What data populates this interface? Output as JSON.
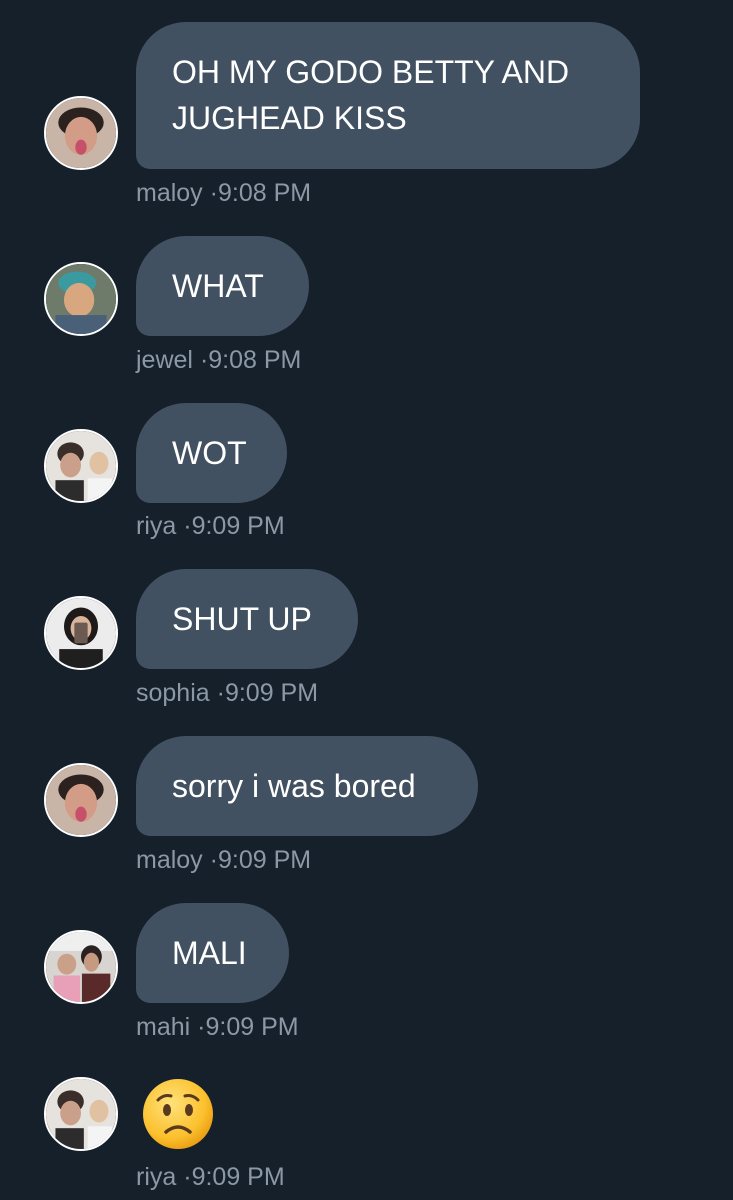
{
  "messages": [
    {
      "text_line1": "OH MY GODO BETTY AND",
      "text_line2": "JUGHEAD KISS",
      "author": "maloy",
      "separator": "·",
      "time": "9:08 PM",
      "avatar": "maloy-avatar"
    },
    {
      "text": "WHAT",
      "author": "jewel",
      "separator": "·",
      "time": "9:08 PM",
      "avatar": "jewel-avatar"
    },
    {
      "text": "WOT",
      "author": "riya",
      "separator": "·",
      "time": "9:09 PM",
      "avatar": "riya-avatar"
    },
    {
      "text": "SHUT UP",
      "author": "sophia",
      "separator": "·",
      "time": "9:09 PM",
      "avatar": "sophia-avatar"
    },
    {
      "text": "sorry i was bored",
      "author": "maloy",
      "separator": "·",
      "time": "9:09 PM",
      "avatar": "maloy-avatar"
    },
    {
      "text": "MALI",
      "author": "mahi",
      "separator": "·",
      "time": "9:09 PM",
      "avatar": "mahi-avatar"
    },
    {
      "emoji": "😟",
      "emoji_name": "worried-face-emoji",
      "author": "riya",
      "separator": "·",
      "time": "9:09 PM",
      "avatar": "riya-avatar"
    }
  ],
  "colors": {
    "background": "#16202b",
    "bubble": "#425161",
    "bubble_text": "#ffffff",
    "meta_text": "#8b98a5"
  }
}
